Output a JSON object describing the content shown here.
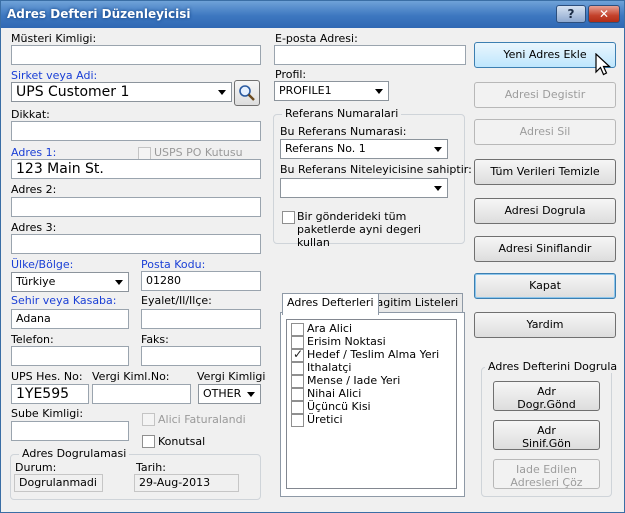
{
  "window": {
    "title": "Adres Defteri Düzenleyicisi",
    "help_label": "?",
    "close_label": "✕"
  },
  "labels": {
    "customer_id": "Müsteri Kimligi:",
    "company": "Sirket veya Adi:",
    "attention": "Dikkat:",
    "address1": "Adres 1:",
    "usps_po": "USPS PO Kutusu",
    "address2": "Adres 2:",
    "address3": "Adres 3:",
    "country": "Ülke/Bölge:",
    "postal": "Posta Kodu:",
    "city": "Sehir veya Kasaba:",
    "state": "Eyalet/Il/Ilçe:",
    "phone": "Telefon:",
    "fax": "Faks:",
    "ups_acct": "UPS Hes. No:",
    "tax_id": "Vergi Kiml.No:",
    "tax_type": "Vergi Kimligi",
    "branch_id": "Sube Kimligi:",
    "bill_receiver": "Alici Faturalandi",
    "residential": "Konutsal",
    "email": "E-posta Adresi:",
    "profile": "Profil:"
  },
  "fields": {
    "customer_id": "",
    "company": "UPS Customer 1",
    "attention": "",
    "address1": "123 Main St.",
    "address2": "",
    "address3": "",
    "country": "Türkiye",
    "postal": "01280",
    "city": "Adana",
    "state": "",
    "phone": "",
    "fax": "",
    "ups_acct": "1YE595",
    "tax_id": "",
    "tax_type": "OTHER",
    "branch_id": "",
    "email": "",
    "profile": "PROFILE1"
  },
  "references": {
    "title": "Referans Numaralari",
    "number_label": "Bu Referans Numarasi:",
    "number_value": "Referans No. 1",
    "qualifier_label": "Bu Referans Niteleyicisine sahiptir:",
    "qualifier_value": "",
    "apply_all": "Bir gönderideki tüm paketlerde ayni degeri kullan"
  },
  "tabs": [
    "Adres Defterleri",
    "Dagitim Listeleri"
  ],
  "address_books": [
    {
      "label": "Ara Alici",
      "checked": false
    },
    {
      "label": "Erisim Noktasi",
      "checked": false
    },
    {
      "label": "Hedef / Teslim Alma Yeri",
      "checked": true
    },
    {
      "label": "Ithalatçi",
      "checked": false
    },
    {
      "label": "Mense / Iade Yeri",
      "checked": false
    },
    {
      "label": "Nihai Alici",
      "checked": false
    },
    {
      "label": "Üçüncü Kisi",
      "checked": false
    },
    {
      "label": "Üretici",
      "checked": false
    }
  ],
  "validation": {
    "title": "Adres Dogrulamasi",
    "status_label": "Durum:",
    "status_value": "Dogrulanmadi",
    "date_label": "Tarih:",
    "date_value": "29-Aug-2013"
  },
  "buttons": {
    "add_new": "Yeni Adres Ekle",
    "modify": "Adresi Degistir",
    "delete": "Adresi Sil",
    "clear_all": "Tüm Verileri Temizle",
    "validate": "Adresi Dogrula",
    "classify": "Adresi Siniflandir",
    "close": "Kapat",
    "help": "Yardim"
  },
  "verify_group": {
    "title": "Adres Defterini Dogrula",
    "btn1_line1": "Adr",
    "btn1_line2": "Dogr.Gönd",
    "btn2_line1": "Adr",
    "btn2_line2": "Sinif.Gön",
    "btn3_line1": "Iade Edilen",
    "btn3_line2": "Adresleri Çöz"
  }
}
